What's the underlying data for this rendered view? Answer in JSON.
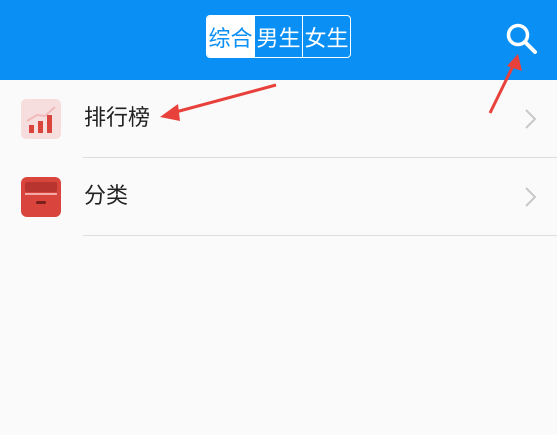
{
  "header": {
    "tabs": [
      {
        "label": "综合",
        "active": true
      },
      {
        "label": "男生",
        "active": false
      },
      {
        "label": "女生",
        "active": false
      }
    ],
    "search_icon": "search-icon",
    "bg_color": "#0a8ff5"
  },
  "list": {
    "items": [
      {
        "label": "排行榜",
        "icon": "ranking-chart-icon"
      },
      {
        "label": "分类",
        "icon": "category-box-icon"
      }
    ]
  },
  "annotation_color": "#e8403a"
}
